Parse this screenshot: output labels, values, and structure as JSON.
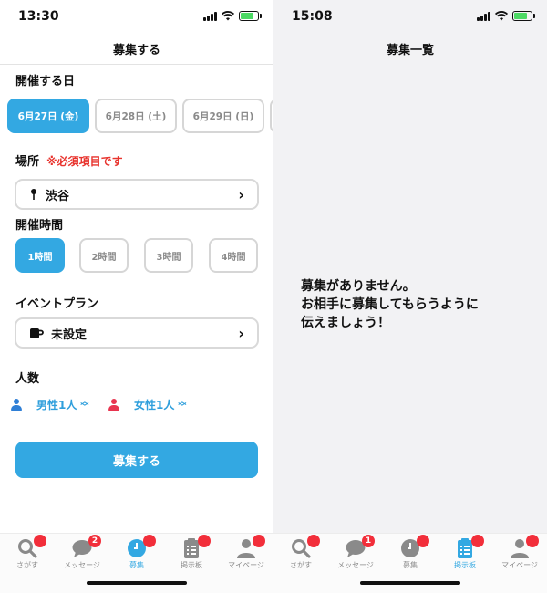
{
  "left": {
    "status": {
      "time": "13:30"
    },
    "nav_title": "募集する",
    "date_section": {
      "label": "開催する日",
      "dates": [
        "6月27日 (金)",
        "6月28日 (土)",
        "6月29日 (日)"
      ],
      "selected_index": 0
    },
    "place_section": {
      "label": "場所",
      "required": "※必須項目です",
      "value": "渋谷"
    },
    "time_section": {
      "label": "開催時間",
      "options": [
        "1時間",
        "2時間",
        "3時間",
        "4時間"
      ],
      "selected_index": 0
    },
    "plan_section": {
      "label": "イベントプラン",
      "value": "未設定"
    },
    "people_section": {
      "label": "人数",
      "male": "男性1人",
      "female": "女性1人"
    },
    "submit_label": "募集する"
  },
  "right": {
    "status": {
      "time": "15:08"
    },
    "nav_title": "募集一覧",
    "empty_message": [
      "募集がありません。",
      "お相手に募集してもらうように",
      "伝えましょう！"
    ]
  },
  "tabbar": {
    "items": [
      {
        "label": "さがす",
        "icon": "search-icon"
      },
      {
        "label": "メッセージ",
        "icon": "chat-icon"
      },
      {
        "label": "募集",
        "icon": "clock-icon"
      },
      {
        "label": "掲示板",
        "icon": "clipboard-icon"
      },
      {
        "label": "マイページ",
        "icon": "person-icon"
      }
    ],
    "left_message_badge": "2",
    "right_message_badge": "1"
  },
  "colors": {
    "accent": "#33a8e2",
    "required": "#e8342e",
    "badge": "#f22e3a",
    "male": "#2f7fd6",
    "female": "#e8344f"
  }
}
